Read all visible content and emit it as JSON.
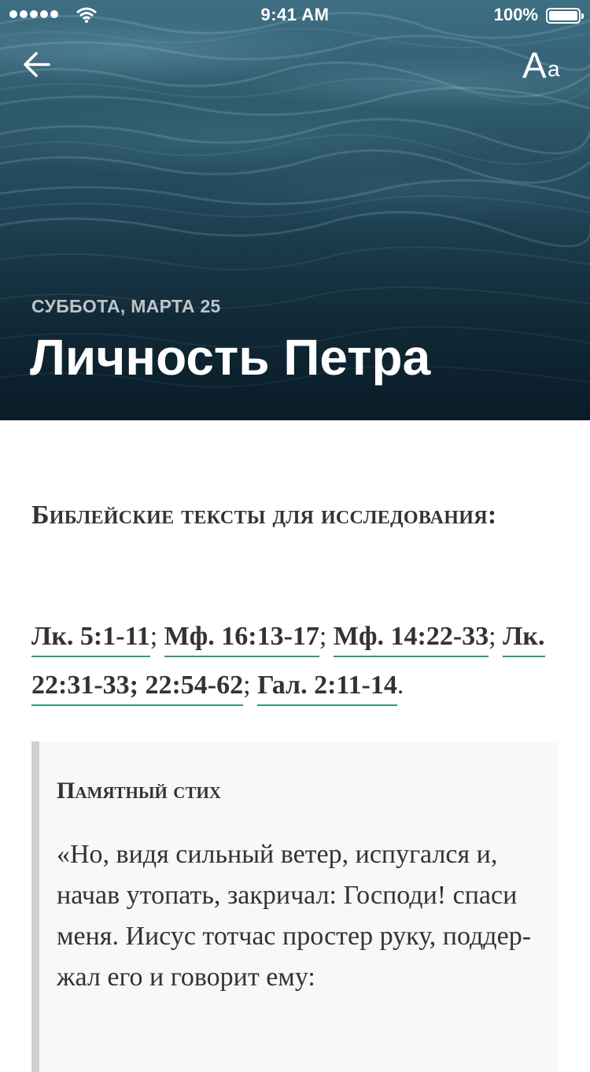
{
  "status_bar": {
    "time": "9:41 AM",
    "battery": "100%"
  },
  "header": {
    "back_icon": "arrow-left-icon",
    "font_settings_icon": "Aa",
    "date": "СУББОТА, МАРТА 25",
    "title": "Личность Петра"
  },
  "section": {
    "heading": "Библейские тексты для исследования:",
    "references": [
      {
        "text": "Лк. 5:1-11",
        "after": "; "
      },
      {
        "text": "Мф. 16:13-17",
        "after": "; "
      },
      {
        "text": "Мф. 14:22-33",
        "after": "; "
      },
      {
        "text": "Лк. 22:31-33; 22:54-62",
        "after": "; "
      },
      {
        "text": "Гал. 2:11-14",
        "after": "."
      }
    ]
  },
  "memory_verse": {
    "title": "Памятный стих",
    "text": "«Но, видя сильный ветер, испугался и, начав утопать, закричал: Господи! спаси меня. Иисус тотчас простер руку, поддер- жал его и говорит ему:"
  },
  "colors": {
    "link_underline": "#2f9a78",
    "quote_border": "#d0d0d0"
  }
}
